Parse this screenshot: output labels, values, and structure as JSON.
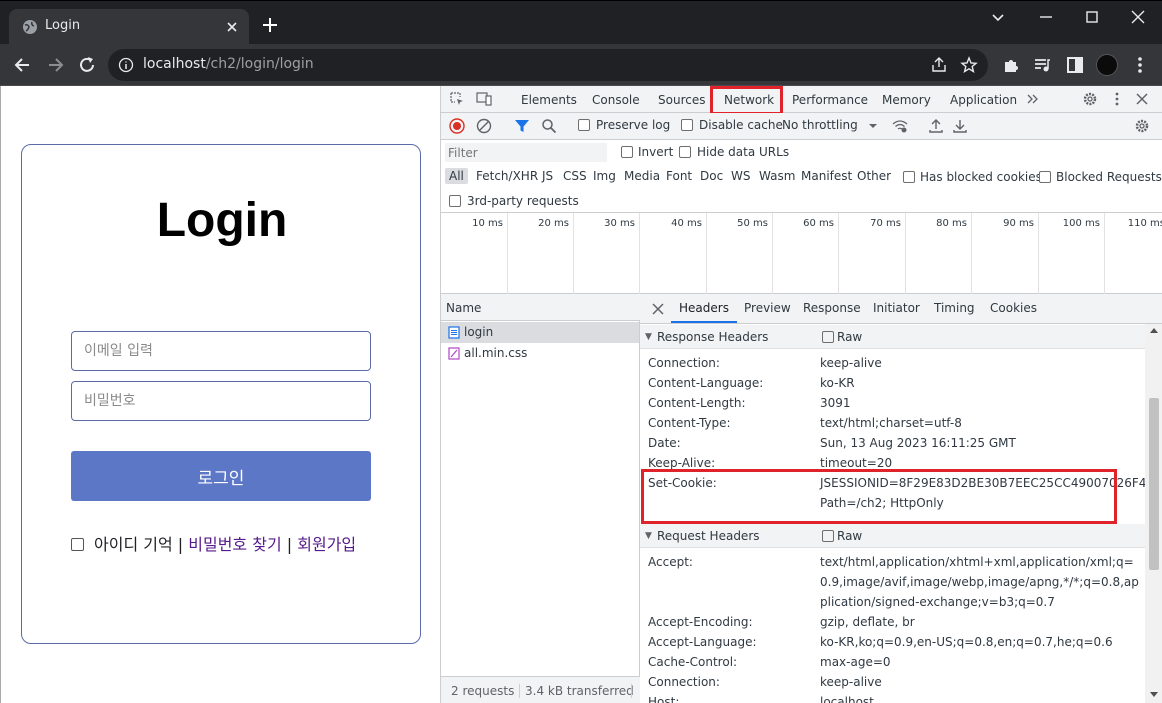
{
  "browser": {
    "tab_title": "Login",
    "url_host": "localhost",
    "url_path": "/ch2/login/login"
  },
  "page": {
    "title": "Login",
    "email_placeholder": "이메일 입력",
    "password_placeholder": "비밀번호",
    "login_button": "로그인",
    "remember_label": "아이디 기억",
    "separator": "|",
    "find_password": "비밀번호 찾기",
    "signup": "회원가입"
  },
  "devtools": {
    "tabs": [
      "Elements",
      "Console",
      "Sources",
      "Network",
      "Performance",
      "Memory",
      "Application"
    ],
    "active_tab": "Network",
    "toolbar": {
      "preserve_log": "Preserve log",
      "disable_cache": "Disable cache",
      "throttling": "No throttling"
    },
    "filter": {
      "placeholder": "Filter",
      "invert": "Invert",
      "hide_data_urls": "Hide data URLs",
      "types": [
        "All",
        "Fetch/XHR",
        "JS",
        "CSS",
        "Img",
        "Media",
        "Font",
        "Doc",
        "WS",
        "Wasm",
        "Manifest",
        "Other"
      ],
      "has_blocked_cookies": "Has blocked cookies",
      "blocked_requests": "Blocked Requests",
      "third_party": "3rd-party requests"
    },
    "timeline_ticks": [
      "10 ms",
      "20 ms",
      "30 ms",
      "40 ms",
      "50 ms",
      "60 ms",
      "70 ms",
      "80 ms",
      "90 ms",
      "100 ms",
      "110 ms"
    ],
    "requests": {
      "column": "Name",
      "items": [
        "login",
        "all.min.css"
      ],
      "summary_requests": "2 requests",
      "summary_transferred": "3.4 kB transferred"
    },
    "detail_tabs": [
      "Headers",
      "Preview",
      "Response",
      "Initiator",
      "Timing",
      "Cookies"
    ],
    "response_headers_title": "Response Headers",
    "raw_label": "Raw",
    "response_headers": [
      {
        "key": "Connection:",
        "value": "keep-alive"
      },
      {
        "key": "Content-Language:",
        "value": "ko-KR"
      },
      {
        "key": "Content-Length:",
        "value": "3091"
      },
      {
        "key": "Content-Type:",
        "value": "text/html;charset=utf-8"
      },
      {
        "key": "Date:",
        "value": "Sun, 13 Aug 2023 16:11:25 GMT"
      },
      {
        "key": "Keep-Alive:",
        "value": "timeout=20"
      },
      {
        "key": "Set-Cookie:",
        "value": "JSESSIONID=8F29E83D2BE30B7EEC25CC49007026F4; Path=/ch2; HttpOnly"
      }
    ],
    "request_headers_title": "Request Headers",
    "request_headers": [
      {
        "key": "Accept:",
        "value": "text/html,application/xhtml+xml,application/xml;q=0.9,image/avif,image/webp,image/apng,*/*;q=0.8,application/signed-exchange;v=b3;q=0.7"
      },
      {
        "key": "Accept-Encoding:",
        "value": "gzip, deflate, br"
      },
      {
        "key": "Accept-Language:",
        "value": "ko-KR,ko;q=0.9,en-US;q=0.8,en;q=0.7,he;q=0.6"
      },
      {
        "key": "Cache-Control:",
        "value": "max-age=0"
      },
      {
        "key": "Connection:",
        "value": "keep-alive"
      },
      {
        "key": "Host:",
        "value": "localhost"
      }
    ],
    "colors": {
      "highlight": "#e0222b",
      "accent": "#1a73e8"
    }
  }
}
